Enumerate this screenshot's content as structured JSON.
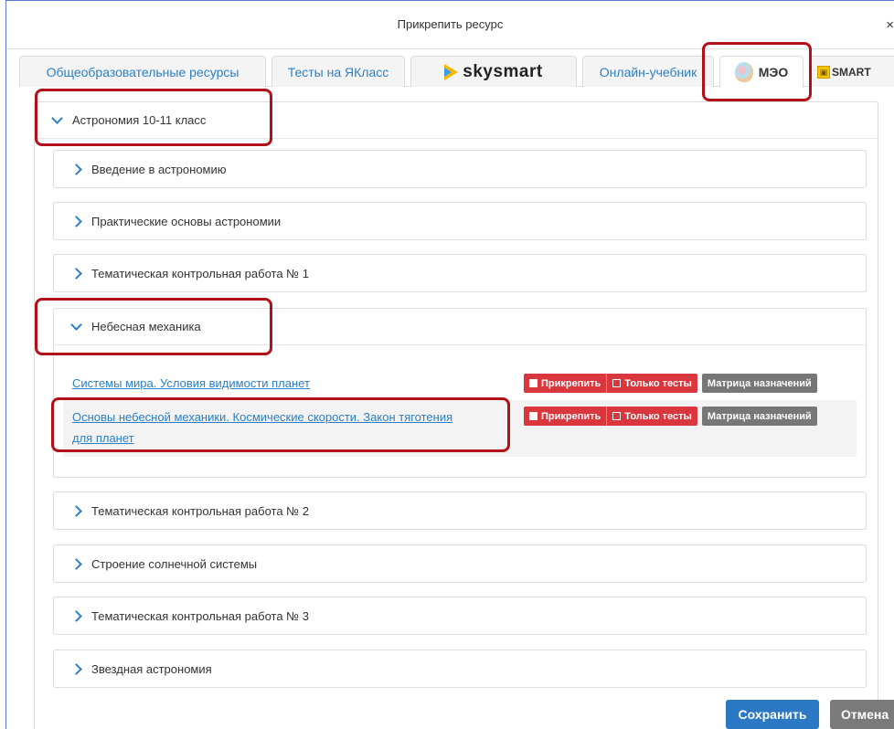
{
  "dialog": {
    "title": "Прикрепить ресурс",
    "close_glyph": "×"
  },
  "tabs": [
    {
      "label": "Общеобразовательные ресурсы"
    },
    {
      "label": "Тесты на ЯКласс"
    },
    {
      "label": "skysmart"
    },
    {
      "label": "Онлайн-учебник"
    },
    {
      "label": "МЭО",
      "active": true
    },
    {
      "label": "SMART"
    }
  ],
  "course": {
    "title": "Астрономия 10-11 класс",
    "expanded": true
  },
  "sections": [
    {
      "title": "Введение в астрономию"
    },
    {
      "title": "Практические основы астрономии"
    },
    {
      "title": "Тематическая контрольная работа № 1"
    },
    {
      "title": "Небесная механика",
      "expanded": true,
      "resources": [
        {
          "title": "Системы мира. Условия видимости планет"
        },
        {
          "title_line1": "Основы небесной механики. Космические скорости. Закон тяготения",
          "title_line2": "для планет"
        }
      ]
    },
    {
      "title": "Тематическая контрольная работа № 2"
    },
    {
      "title": "Строение солнечной системы"
    },
    {
      "title": "Тематическая контрольная работа № 3"
    },
    {
      "title": "Звездная астрономия"
    }
  ],
  "resource_buttons": {
    "attach": "Прикрепить",
    "tests_only": "Только тесты",
    "matrix": "Матрица назначений"
  },
  "footer": {
    "save": "Сохранить",
    "cancel": "Отмена"
  },
  "colors": {
    "link": "#2b7fc7",
    "danger": "#d9363e",
    "primary": "#2b78c5",
    "highlight": "#b3111a"
  }
}
